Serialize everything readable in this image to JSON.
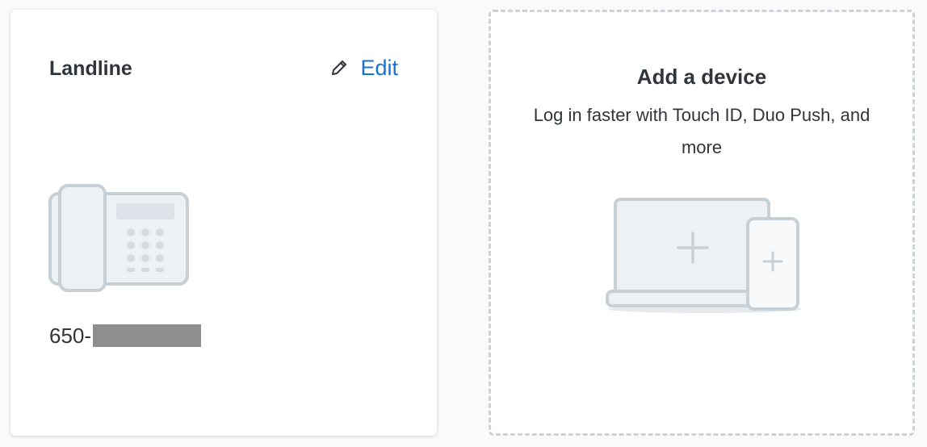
{
  "landline_card": {
    "title": "Landline",
    "edit_label": "Edit",
    "phone_number_prefix": "650-",
    "icons": {
      "edit": "pencil-icon",
      "device": "desk-phone-icon"
    }
  },
  "add_device_card": {
    "title": "Add a device",
    "description": "Log in faster with Touch ID, Duo Push, and more",
    "icons": {
      "illustration": "laptop-phone-add-icon"
    }
  },
  "colors": {
    "link": "#1573d6",
    "text": "#30353b",
    "illustration_stroke": "#c6d0d6",
    "illustration_fill": "#edf1f4",
    "dashed_border": "#cfd2d4"
  }
}
